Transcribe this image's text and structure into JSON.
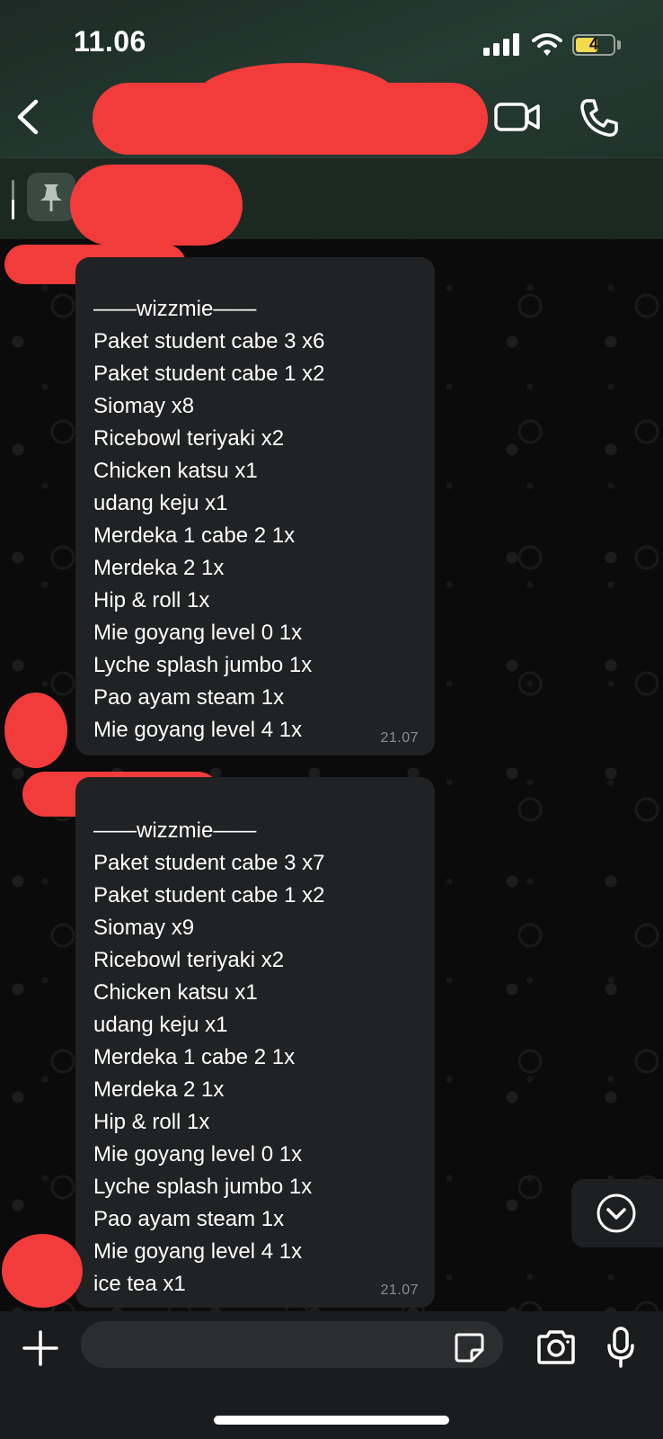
{
  "status_bar": {
    "time": "11.06",
    "battery": "4"
  },
  "header": {
    "contact_name": ""
  },
  "pinned": {
    "text": ""
  },
  "messages": [
    {
      "lines": [
        "——wizzmie——",
        "Paket student cabe 3 x6",
        "Paket student cabe 1 x2",
        "Siomay x8",
        "Ricebowl teriyaki x2",
        "Chicken katsu x1",
        "udang keju x1",
        "Merdeka 1 cabe 2 1x",
        "Merdeka 2 1x",
        "Hip & roll 1x",
        "Mie goyang level 0 1x",
        "Lyche splash jumbo 1x",
        "Pao ayam steam 1x",
        "Mie goyang level 4 1x"
      ],
      "time": "21.07"
    },
    {
      "lines": [
        "——wizzmie——",
        "Paket student cabe 3 x7",
        "Paket student cabe 1 x2",
        "Siomay x9",
        "Ricebowl teriyaki x2",
        "Chicken katsu x1",
        "udang keju x1",
        "Merdeka 1 cabe 2 1x",
        "Merdeka 2 1x",
        "Hip & roll 1x",
        "Mie goyang level 0 1x",
        "Lyche splash jumbo 1x",
        "Pao ayam steam 1x",
        "Mie goyang level 4 1x",
        "ice tea x1"
      ],
      "time": "21.07"
    }
  ],
  "composer": {
    "placeholder": ""
  },
  "icons": {
    "back": "chevron-left-icon",
    "video_call": "video-camera-icon",
    "voice_call": "phone-icon",
    "pin": "pin-icon",
    "scroll_down": "chevron-down-circle-icon",
    "attach": "plus-icon",
    "sticker": "sticker-icon",
    "camera": "camera-icon",
    "mic": "microphone-icon"
  },
  "colors": {
    "header_bg": "#243b32",
    "bubble_bg": "#202223",
    "redaction": "#f23b3b",
    "battery_fill": "#f3d94e"
  }
}
